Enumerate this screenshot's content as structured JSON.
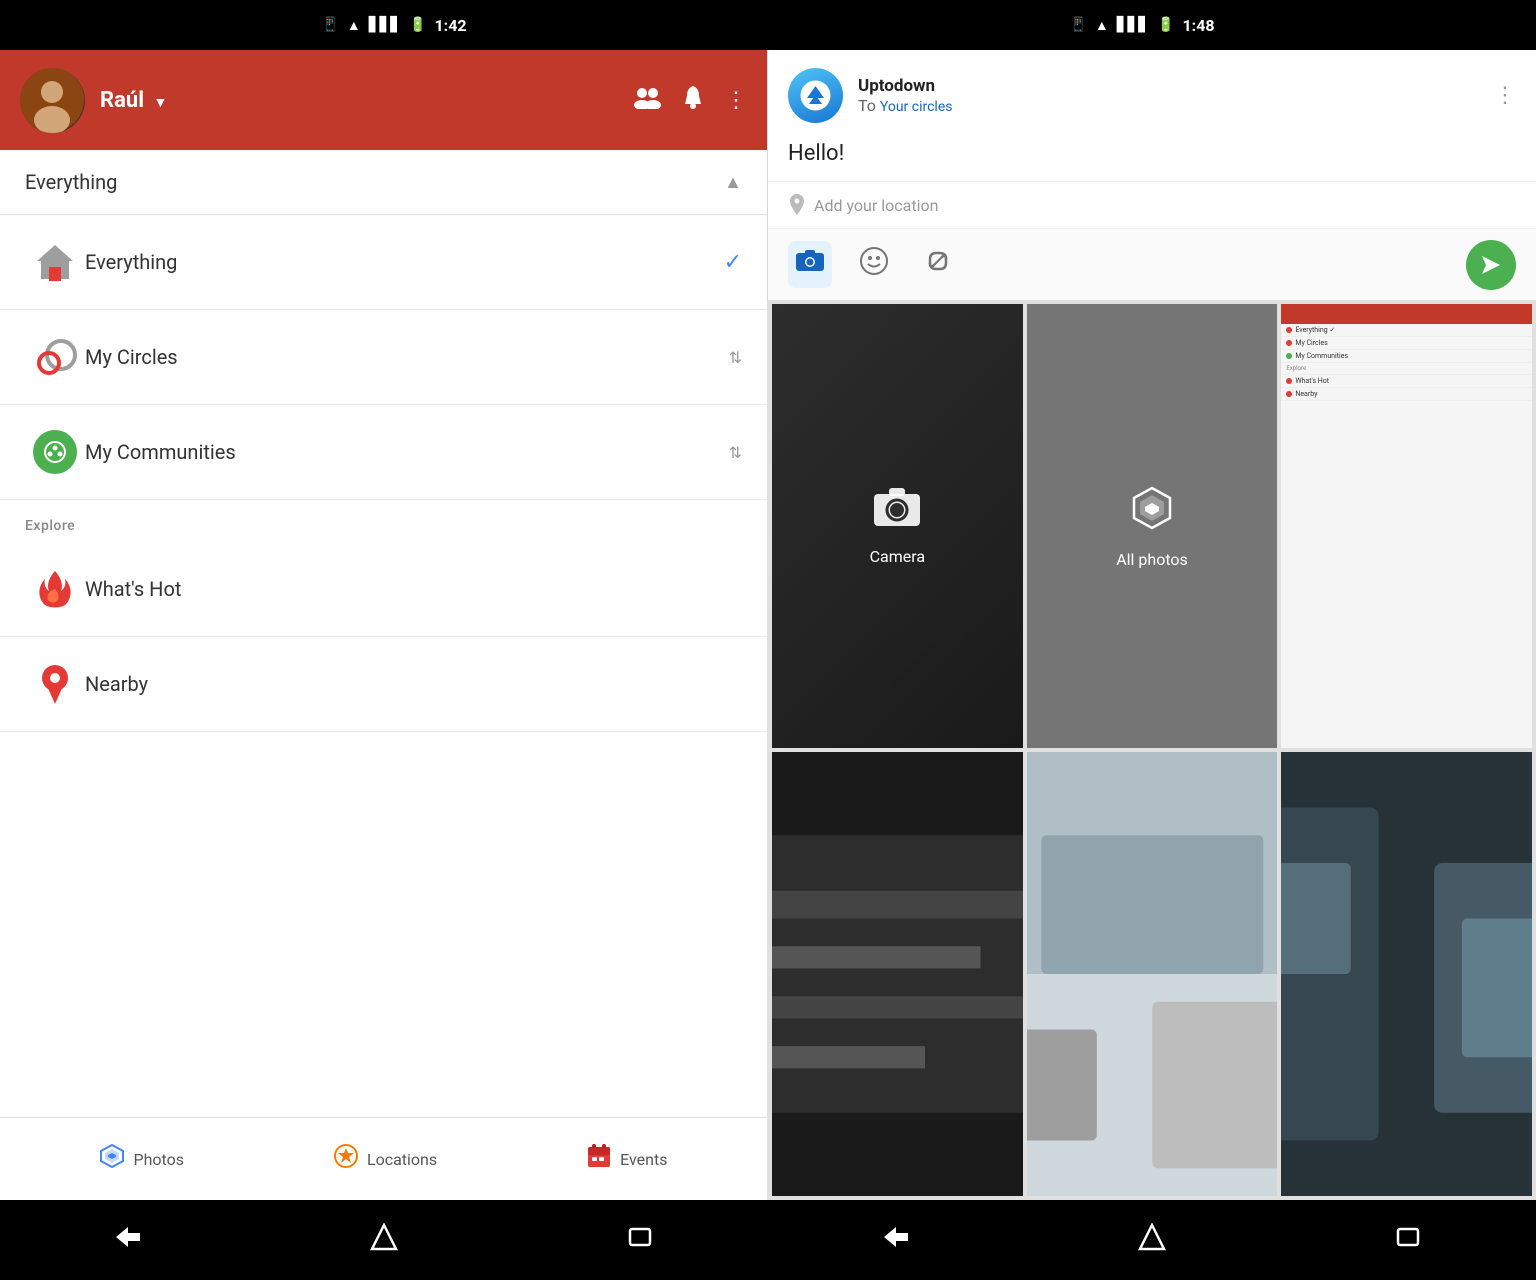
{
  "statusBar": {
    "leftTime": "1:42",
    "rightTime": "1:48"
  },
  "leftPanel": {
    "header": {
      "userName": "Raúl",
      "dropdownLabel": "▼"
    },
    "sectionHeader": {
      "title": "Everything",
      "collapseIcon": "▲"
    },
    "navItems": [
      {
        "id": "everything",
        "label": "Everything",
        "hasCheck": true,
        "hasExpand": false
      },
      {
        "id": "my-circles",
        "label": "My Circles",
        "hasCheck": false,
        "hasExpand": true
      },
      {
        "id": "my-communities",
        "label": "My Communities",
        "hasCheck": false,
        "hasExpand": true
      }
    ],
    "exploreLabel": "Explore",
    "exploreItems": [
      {
        "id": "whats-hot",
        "label": "What's Hot"
      },
      {
        "id": "nearby",
        "label": "Nearby"
      }
    ],
    "bottomNav": [
      {
        "id": "photos",
        "label": "Photos"
      },
      {
        "id": "locations",
        "label": "Locations"
      },
      {
        "id": "events",
        "label": "Events"
      }
    ]
  },
  "rightPanel": {
    "post": {
      "authorName": "Uptodown",
      "toText": "To",
      "circleText": "Your circles",
      "content": "Hello!",
      "locationPlaceholder": "Add your location",
      "menuIcon": "⋮"
    },
    "photoGrid": [
      {
        "id": "camera",
        "label": "Camera",
        "type": "camera"
      },
      {
        "id": "all-photos",
        "label": "All photos",
        "type": "all-photos"
      },
      {
        "id": "screenshot",
        "label": "",
        "type": "screenshot"
      },
      {
        "id": "photo-bottom-left",
        "label": "",
        "type": "photo-dark"
      },
      {
        "id": "photo-bottom-mid",
        "label": "",
        "type": "photo-light"
      },
      {
        "id": "photo-bottom-right",
        "label": "",
        "type": "photo-dark2"
      }
    ]
  },
  "systemNav": {
    "backIcon": "←",
    "homeIcon": "⬡",
    "recentIcon": "▭"
  }
}
